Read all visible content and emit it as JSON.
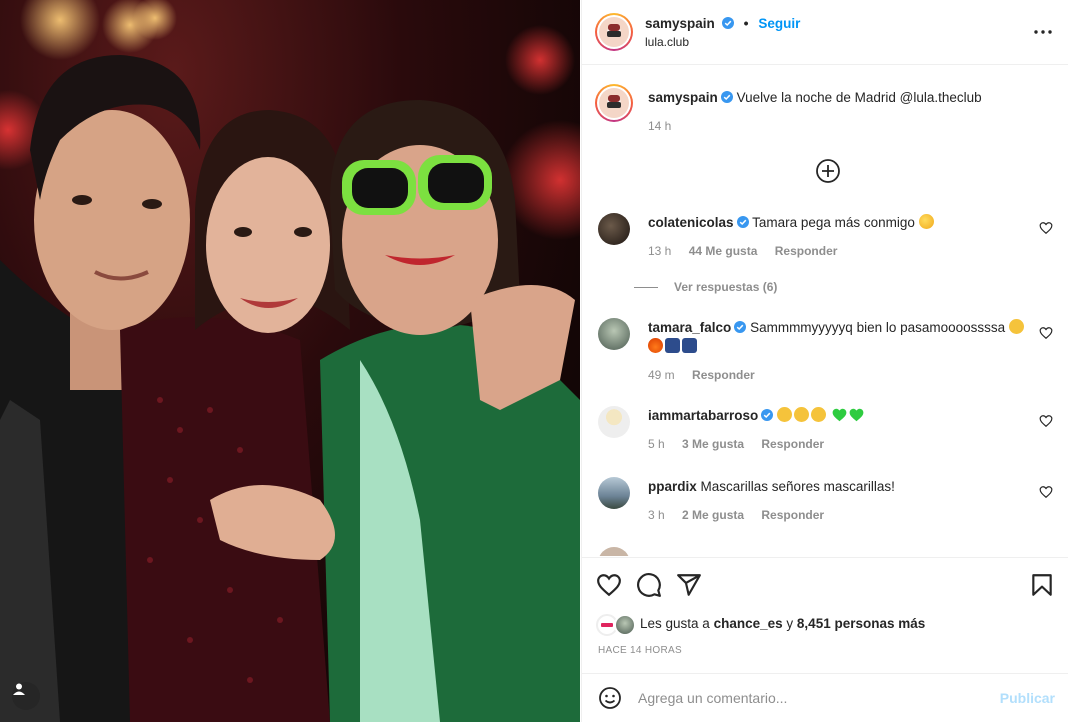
{
  "post": {
    "username": "samyspain",
    "follow_label": "Seguir",
    "location": "lula.club",
    "caption_text": "Vuelve la noche de Madrid @lula.theclub",
    "caption_time": "14 h"
  },
  "comments": [
    {
      "username": "colatenicolas",
      "text": "Tamara pega más conmigo",
      "time": "13 h",
      "likes": "44 Me gusta",
      "reply_label": "Responder",
      "view_replies": "Ver respuestas (6)"
    },
    {
      "username": "tamara_falco",
      "text": "Sammmmyyyyyq bien lo pasamoooossssa",
      "time": "49 m",
      "reply_label": "Responder"
    },
    {
      "username": "iammartabarroso",
      "text": "",
      "time": "5 h",
      "likes": "3 Me gusta",
      "reply_label": "Responder"
    },
    {
      "username": "ppardix",
      "text": "Mascarillas señores mascarillas!",
      "time": "3 h",
      "likes": "2 Me gusta",
      "reply_label": "Responder"
    }
  ],
  "likes": {
    "prefix": "Les gusta a",
    "user": "chance_es",
    "joiner": "y",
    "others": "8,451 personas más"
  },
  "time_ago": "HACE 14 HORAS",
  "comment_box": {
    "placeholder": "Agrega un comentario...",
    "publish_label": "Publicar"
  },
  "colors": {
    "link_blue": "#0095f6",
    "verified_blue": "#3897f0",
    "muted": "#8e8e8e",
    "publish_disabled": "#b2dffc",
    "green_heart": "#2ecc40"
  },
  "icons": [
    "verified-icon",
    "more-options-icon",
    "add-circle-icon",
    "heart-icon",
    "comment-icon",
    "share-icon",
    "bookmark-icon",
    "emoji-icon",
    "user-tag-icon"
  ]
}
